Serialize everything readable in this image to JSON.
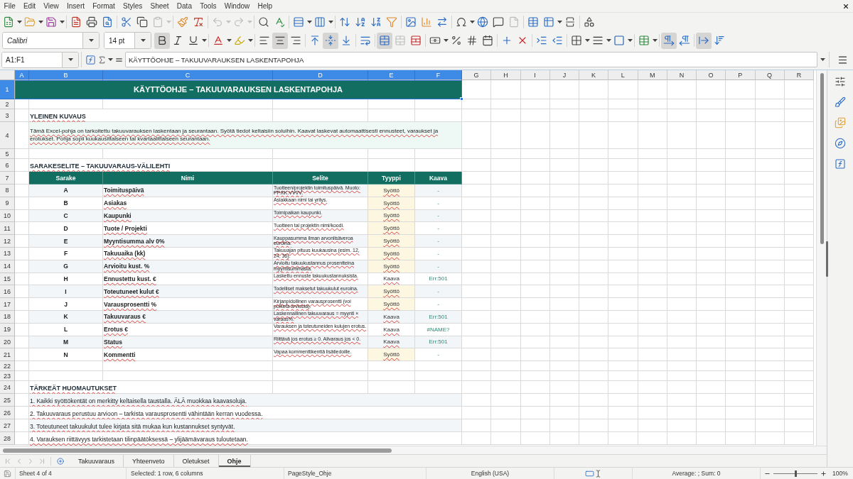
{
  "menu_bar": {
    "items": [
      "File",
      "Edit",
      "View",
      "Insert",
      "Format",
      "Styles",
      "Sheet",
      "Data",
      "Tools",
      "Window",
      "Help"
    ]
  },
  "standard_toolbar": {
    "groups": [
      [
        {
          "kind": "new",
          "dropdown": true,
          "disabled": false
        },
        {
          "kind": "open",
          "dropdown": true,
          "disabled": false
        },
        {
          "kind": "save",
          "dropdown": true,
          "disabled": false
        }
      ],
      [
        {
          "kind": "pdf",
          "dropdown": false,
          "disabled": false
        },
        {
          "kind": "print",
          "dropdown": false,
          "disabled": false
        },
        {
          "kind": "preview",
          "dropdown": false,
          "disabled": false
        }
      ],
      [
        {
          "kind": "cut",
          "dropdown": false,
          "disabled": false
        },
        {
          "kind": "copy",
          "dropdown": false,
          "disabled": false
        },
        {
          "kind": "paste",
          "dropdown": true,
          "disabled": true
        }
      ],
      [
        {
          "kind": "clone",
          "dropdown": false,
          "disabled": false
        },
        {
          "kind": "clear",
          "dropdown": false,
          "disabled": false
        }
      ],
      [
        {
          "kind": "undo",
          "dropdown": true,
          "disabled": true
        },
        {
          "kind": "redo",
          "dropdown": true,
          "disabled": true
        }
      ],
      [
        {
          "kind": "find",
          "dropdown": false,
          "disabled": false
        },
        {
          "kind": "spelling",
          "dropdown": false,
          "disabled": false
        }
      ],
      [
        {
          "kind": "rows",
          "dropdown": true,
          "disabled": false
        },
        {
          "kind": "columns",
          "dropdown": true,
          "disabled": false
        }
      ],
      [
        {
          "kind": "sort",
          "dropdown": false,
          "disabled": false
        },
        {
          "kind": "ascending",
          "dropdown": false,
          "disabled": false
        },
        {
          "kind": "descending",
          "dropdown": false,
          "disabled": false
        },
        {
          "kind": "filter",
          "dropdown": false,
          "disabled": false
        }
      ],
      [
        {
          "kind": "image",
          "dropdown": false,
          "disabled": false
        },
        {
          "kind": "chart",
          "dropdown": false,
          "disabled": false
        },
        {
          "kind": "pivot",
          "dropdown": false,
          "disabled": false
        }
      ],
      [
        {
          "kind": "symbol",
          "dropdown": true,
          "disabled": false
        },
        {
          "kind": "hyperlink",
          "dropdown": false,
          "disabled": false
        },
        {
          "kind": "comment",
          "dropdown": false,
          "disabled": false
        },
        {
          "kind": "headerfooter",
          "dropdown": false,
          "disabled": true
        }
      ],
      [
        {
          "kind": "printarea",
          "dropdown": false,
          "disabled": false
        },
        {
          "kind": "freeze",
          "dropdown": true,
          "disabled": false
        },
        {
          "kind": "split",
          "dropdown": false,
          "disabled": false
        }
      ],
      [
        {
          "kind": "draw",
          "dropdown": false,
          "disabled": false
        }
      ]
    ]
  },
  "formatting_toolbar": {
    "font_name": "Calibri",
    "font_size": "14 pt",
    "groups": [
      [
        {
          "kind": "bold",
          "on": true,
          "dropdown": false,
          "disabled": false
        },
        {
          "kind": "italic",
          "on": false,
          "dropdown": false,
          "disabled": false
        },
        {
          "kind": "underline",
          "on": false,
          "dropdown": true,
          "disabled": false
        }
      ],
      [
        {
          "kind": "fontcolor",
          "on": false,
          "dropdown": true,
          "disabled": false
        },
        {
          "kind": "highlight",
          "on": false,
          "dropdown": true,
          "disabled": false
        }
      ],
      [
        {
          "kind": "left",
          "on": false,
          "dropdown": false,
          "disabled": false
        },
        {
          "kind": "center",
          "on": true,
          "dropdown": false,
          "disabled": false
        },
        {
          "kind": "right",
          "on": false,
          "dropdown": false,
          "disabled": false
        }
      ],
      [
        {
          "kind": "top",
          "on": false,
          "dropdown": false,
          "disabled": false
        },
        {
          "kind": "middle",
          "on": true,
          "dropdown": false,
          "disabled": false
        },
        {
          "kind": "bottom",
          "on": false,
          "dropdown": false,
          "disabled": false
        }
      ],
      [
        {
          "kind": "wrap",
          "on": false,
          "dropdown": false,
          "disabled": false
        }
      ],
      [
        {
          "kind": "mergecenter",
          "on": true,
          "dropdown": false,
          "disabled": false
        },
        {
          "kind": "merge",
          "on": false,
          "dropdown": false,
          "disabled": true
        },
        {
          "kind": "unmerge",
          "on": false,
          "dropdown": false,
          "disabled": false
        }
      ],
      [
        {
          "kind": "number",
          "on": false,
          "dropdown": true,
          "disabled": false
        },
        {
          "kind": "percent",
          "on": false,
          "dropdown": false,
          "disabled": false
        },
        {
          "kind": "standard",
          "on": false,
          "dropdown": false,
          "disabled": false
        },
        {
          "kind": "date",
          "on": false,
          "dropdown": false,
          "disabled": false
        }
      ],
      [
        {
          "kind": "adddecimal",
          "on": false,
          "dropdown": false,
          "disabled": false
        },
        {
          "kind": "deletedecimal",
          "on": false,
          "dropdown": false,
          "disabled": false
        }
      ],
      [
        {
          "kind": "indent",
          "on": false,
          "dropdown": false,
          "disabled": false
        },
        {
          "kind": "outdent",
          "on": false,
          "dropdown": false,
          "disabled": false
        }
      ],
      [
        {
          "kind": "borders",
          "on": false,
          "dropdown": true,
          "disabled": false
        },
        {
          "kind": "borderstyle",
          "on": false,
          "dropdown": true,
          "disabled": false
        },
        {
          "kind": "bordercolor",
          "on": false,
          "dropdown": true,
          "disabled": false
        }
      ],
      [
        {
          "kind": "conditional",
          "on": false,
          "dropdown": true,
          "disabled": false
        }
      ],
      [
        {
          "kind": "ltr",
          "on": true,
          "dropdown": false,
          "disabled": false
        },
        {
          "kind": "rtl",
          "on": false,
          "dropdown": false,
          "disabled": false
        }
      ],
      [
        {
          "kind": "horizontal",
          "on": true,
          "dropdown": false,
          "disabled": false
        },
        {
          "kind": "vertical",
          "on": false,
          "dropdown": false,
          "disabled": false
        }
      ]
    ]
  },
  "formula_bar": {
    "name_box": "A1:F1",
    "formula": "KÄYTTÖOHJE – TAKUUVARAUKSEN LASKENTAPOHJA"
  },
  "sheet": {
    "autospell": true,
    "columns": [
      {
        "label": "A",
        "selected": true
      },
      {
        "label": "B",
        "selected": true
      },
      {
        "label": "C",
        "selected": true
      },
      {
        "label": "D",
        "selected": true
      },
      {
        "label": "E",
        "selected": true
      },
      {
        "label": "F",
        "selected": true
      },
      {
        "label": "G",
        "selected": false
      },
      {
        "label": "H",
        "selected": false
      },
      {
        "label": "I",
        "selected": false
      },
      {
        "label": "J",
        "selected": false
      },
      {
        "label": "K",
        "selected": false
      },
      {
        "label": "L",
        "selected": false
      },
      {
        "label": "M",
        "selected": false
      },
      {
        "label": "N",
        "selected": false
      },
      {
        "label": "O",
        "selected": false
      },
      {
        "label": "P",
        "selected": false
      },
      {
        "label": "Q",
        "selected": false
      },
      {
        "label": "R",
        "selected": false
      }
    ],
    "rows": [
      {
        "header": "1",
        "selected": true,
        "kind": "title",
        "text": "KÄYTTÖOHJE – TAKUUVARAUKSEN LASKENTAPOHJA"
      },
      {
        "header": "2",
        "selected": false,
        "kind": "blank"
      },
      {
        "header": "3",
        "selected": false,
        "kind": "heading",
        "text": "YLEINEN KUVAUS"
      },
      {
        "header": "4",
        "selected": false,
        "kind": "paragraph",
        "text": "Tämä Excel-pohja on tarkoitettu takuuvarauksen laskentaan ja seurantaan. Syötä tiedot keltaisiin soluihin. Kaavat laskevat automaattisesti ennusteet, varaukset ja erotukset. Pohja sopii kuukausittaiseen tai kvartaalittaiseen seurantaan."
      },
      {
        "header": "5",
        "selected": false,
        "kind": "blank"
      },
      {
        "header": "6",
        "selected": false,
        "kind": "heading",
        "text": "SARAKESELITE – TAKUUVARAUS-VÄLILEHTI"
      },
      {
        "header": "7",
        "selected": false,
        "kind": "table_header",
        "cells": [
          "Sarake",
          "Nimi",
          "Selite",
          "Tyyppi",
          "Kaava"
        ]
      },
      {
        "header": "8",
        "selected": false,
        "kind": "field",
        "letter": "A",
        "name": "Toimituspäivä",
        "description": "Tuotteen/projektin toimituspäivä. Muoto: PP.KK.VVVV.",
        "type": "Syöttö",
        "input": true,
        "formula": "-"
      },
      {
        "header": "9",
        "selected": false,
        "kind": "field",
        "letter": "B",
        "name": "Asiakas",
        "description": "Asiakkaan nimi tai yritys.",
        "type": "Syöttö",
        "input": true,
        "formula": "-"
      },
      {
        "header": "10",
        "selected": false,
        "kind": "field",
        "letter": "C",
        "name": "Kaupunki",
        "description": "Toimipaikan kaupunki.",
        "type": "Syöttö",
        "input": true,
        "formula": "-"
      },
      {
        "header": "11",
        "selected": false,
        "kind": "field",
        "letter": "D",
        "name": "Tuote / Projekti",
        "description": "Tuotteen tai projektin nimi/koodi.",
        "type": "Syöttö",
        "input": true,
        "formula": "-"
      },
      {
        "header": "12",
        "selected": false,
        "kind": "field",
        "letter": "E",
        "name": "Myyntisumma alv 0%",
        "description": "Kauppasumma ilman arvonlisäveroa euroina.",
        "type": "Syöttö",
        "input": true,
        "formula": "-"
      },
      {
        "header": "13",
        "selected": false,
        "kind": "field",
        "letter": "F",
        "name": "Takuuaika (kk)",
        "description": "Takuuajan pituus kuukausina (esim. 12, 24, 36).",
        "type": "Syöttö",
        "input": true,
        "formula": "-"
      },
      {
        "header": "14",
        "selected": false,
        "kind": "field",
        "letter": "G",
        "name": "Arvioitu kust. %",
        "description": "Arvioitu takuukustannus prosentteina myyntisummasta.",
        "type": "Syöttö",
        "input": true,
        "formula": "-"
      },
      {
        "header": "15",
        "selected": false,
        "kind": "field",
        "letter": "H",
        "name": "Ennustettu kust. €",
        "description": "Laskettu ennuste takuukustannuksista.",
        "type": "Kaava",
        "input": false,
        "formula": "Err:501"
      },
      {
        "header": "16",
        "selected": false,
        "kind": "field",
        "letter": "I",
        "name": "Toteutuneet kulut €",
        "description": "Todelliset maksetut takuukulut euroina.",
        "type": "Syöttö",
        "input": true,
        "formula": "-"
      },
      {
        "header": "17",
        "selected": false,
        "kind": "field",
        "letter": "J",
        "name": "Varausprosentti %",
        "description": "Kirjanpidollinen varausprosentti (voi poiketa arviosta).",
        "type": "Syöttö",
        "input": true,
        "formula": "-"
      },
      {
        "header": "18",
        "selected": false,
        "kind": "field",
        "letter": "K",
        "name": "Takuuvaraus €",
        "description": "Laskennallinen takuuvaraus = myynti × varaus%.",
        "type": "Kaava",
        "input": false,
        "formula": "Err:501"
      },
      {
        "header": "19",
        "selected": false,
        "kind": "field",
        "letter": "L",
        "name": "Erotus €",
        "description": "Varauksen ja toteutuneiden kulujen erotus.",
        "type": "Kaava",
        "input": false,
        "formula": "#NAME?"
      },
      {
        "header": "20",
        "selected": false,
        "kind": "field",
        "letter": "M",
        "name": "Status",
        "description": "Riittävä jos erotus ≥ 0. Alivaraus jos < 0.",
        "type": "Kaava",
        "input": false,
        "formula": "Err:501"
      },
      {
        "header": "21",
        "selected": false,
        "kind": "field",
        "letter": "N",
        "name": "Kommentti",
        "description": "Vapaa kommenttikenttä lisätiedoille.",
        "type": "Syöttö",
        "input": true,
        "formula": "-"
      },
      {
        "header": "22",
        "selected": false,
        "kind": "blank"
      },
      {
        "header": "23",
        "selected": false,
        "kind": "blank"
      },
      {
        "header": "24",
        "selected": false,
        "kind": "heading",
        "text": "TÄRKEÄT HUOMAUTUKSET"
      },
      {
        "header": "25",
        "selected": false,
        "kind": "note",
        "text": "1. Kaikki syöttökentät on merkitty keltaisella taustalla. ÄLÄ muokkaa kaavasoluja."
      },
      {
        "header": "26",
        "selected": false,
        "kind": "note",
        "text": "2. Takuuvaraus perustuu arvioon – tarkista varausprosentti vähintään kerran vuodessa."
      },
      {
        "header": "27",
        "selected": false,
        "kind": "note",
        "text": "3. Toteutuneet takuukulut tulee kirjata sitä mukaa kun kustannukset syntyvät."
      },
      {
        "header": "28",
        "selected": false,
        "kind": "note",
        "text": "4. Varauksen riittävyys tarkistetaan tilinpäätöksessä – ylijäämävaraus tuloutetaan."
      }
    ]
  },
  "sheet_tabs": {
    "navigation_disabled": true,
    "tabs": [
      {
        "label": "Takuuvaraus",
        "selected": false
      },
      {
        "label": "Yhteenveto",
        "selected": false
      },
      {
        "label": "Oletukset",
        "selected": false
      },
      {
        "label": "Ohje",
        "selected": true
      }
    ]
  },
  "status_bar": {
    "sheet": "Sheet 4 of 4",
    "selection": "Selected: 1 row, 6 columns",
    "page_style": "PageStyle_Ohje",
    "language": "English (USA)",
    "summary": "Average: ; Sum: 0",
    "zoom": {
      "level": 0.5,
      "reading": "100%"
    }
  }
}
